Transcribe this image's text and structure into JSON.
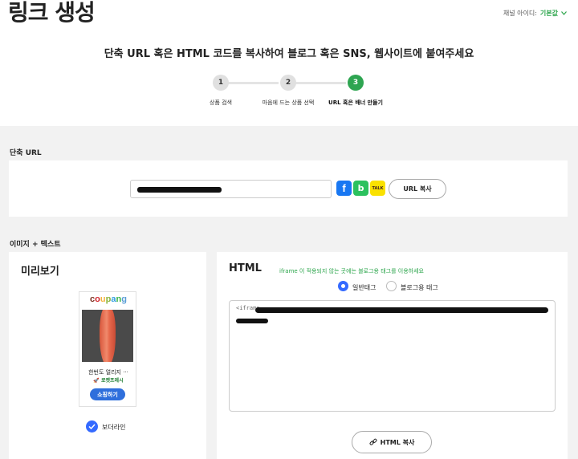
{
  "header": {
    "title": "링크 생성",
    "channel_label": "채널 아이디:",
    "channel_value": "기본값"
  },
  "subtitle": "단축 URL 혹은 HTML 코드를 복사하여 블로그 혹은 SNS, 웹사이트에 붙여주세요",
  "steps": [
    {
      "number": "1",
      "label": "상품 검색",
      "active": false
    },
    {
      "number": "2",
      "label": "마음에 드는 상품 선택",
      "active": false
    },
    {
      "number": "3",
      "label": "URL 혹은 배너 만들기",
      "active": true
    }
  ],
  "short_url_section": {
    "label": "단축 URL",
    "copy_button": "URL 복사",
    "sns": [
      {
        "name": "facebook",
        "glyph": "f"
      },
      {
        "name": "band",
        "glyph": "b"
      },
      {
        "name": "kakaotalk",
        "glyph": "TALK"
      }
    ]
  },
  "image_text_section": {
    "label": "이미지 + 텍스트",
    "preview": {
      "title": "미리보기",
      "logo_letters": [
        "c",
        "o",
        "u",
        "p",
        "a",
        "n",
        "g"
      ],
      "logo_colors": [
        "#7a2e1d",
        "#d2232a",
        "#f4b33d",
        "#8ab43b",
        "#2f9be0",
        "#38b54a",
        "#5a9ed6"
      ],
      "product_name": "한번도 얼리지 ···",
      "delivery_badge": "로켓프레시",
      "shop_button": "쇼핑하기",
      "border_line_label": "보더라인",
      "border_line_checked": true
    },
    "html": {
      "title": "HTML",
      "note": "iframe 이 적용되지 않는 곳에는 블로그용 태그를 이용하세요",
      "radio_options": [
        {
          "label": "일반태그",
          "checked": true
        },
        {
          "label": "블로그용 태그",
          "checked": false
        }
      ],
      "code_prefix": "<iframe",
      "copy_button": "HTML 복사"
    }
  },
  "colors": {
    "accent_green": "#2ea551",
    "accent_blue": "#346aff",
    "background_gray": "#f2f2f2"
  }
}
